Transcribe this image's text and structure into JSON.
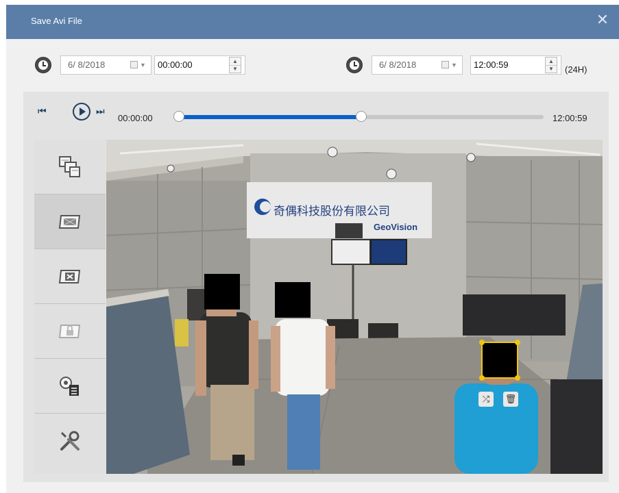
{
  "dialog": {
    "title": "Save Avi File",
    "close_glyph": "✕"
  },
  "range": {
    "start": {
      "date": "6/  8/2018",
      "time": "00:00:00",
      "icon": "clock-icon"
    },
    "end": {
      "date": "6/  8/2018",
      "time": "12:00:59",
      "icon": "clock-icon"
    },
    "format_hint": "(24H)"
  },
  "player": {
    "prev_glyph": "⏮",
    "next_glyph": "⏭",
    "start_time": "00:00:00",
    "end_time": "12:00:59",
    "progress": 0.5,
    "colors": {
      "track": "#c8c8c8",
      "fill": "#0a62c9"
    }
  },
  "tools": [
    {
      "icon": "multi-view-icon"
    },
    {
      "icon": "privacy-mask-icon"
    },
    {
      "icon": "remove-mask-icon"
    },
    {
      "icon": "lock-mask-icon"
    },
    {
      "icon": "camera-list-icon"
    },
    {
      "icon": "settings-tools-icon"
    }
  ],
  "video": {
    "signage_text": "奇偶科技股份有限公司",
    "signage_subtext": "GeoVision",
    "mask_actions": {
      "shuffle_glyph": "⤮",
      "delete_glyph": "🗑"
    }
  }
}
